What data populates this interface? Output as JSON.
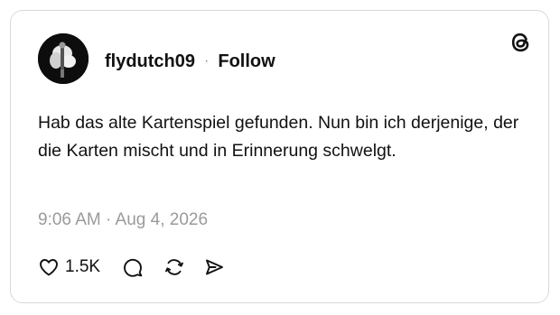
{
  "post": {
    "username": "flydutch09",
    "separator": "·",
    "follow_label": "Follow",
    "text": "Hab das alte Kartenspiel gefunden. Nun bin ich derjenige, der die Karten mischt und in Erinnerung schwelgt.",
    "timestamp": "9:06 AM · Aug 4, 2026",
    "like_count": "1.5K"
  },
  "icons": {
    "brand": "threads-logo-icon",
    "like": "heart-icon",
    "reply": "comment-icon",
    "repost": "repost-icon",
    "share": "send-icon"
  },
  "colors": {
    "text": "#111111",
    "muted": "#9a9a9a",
    "border": "#d9d9d9"
  }
}
